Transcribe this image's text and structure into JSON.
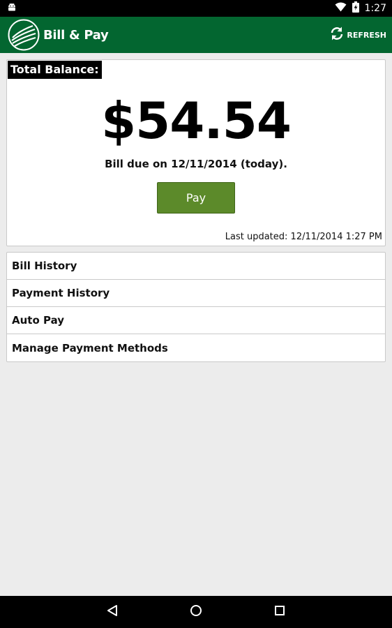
{
  "status_bar": {
    "time": "1:27",
    "left_icon": "android-debug-icon",
    "right_icons": [
      "wifi-icon",
      "battery-charging-icon"
    ]
  },
  "action_bar": {
    "title": "Bill & Pay",
    "logo_icon": "co-op-logo-icon",
    "refresh_label": "REFRESH",
    "refresh_icon": "refresh-icon",
    "background_color": "#036630"
  },
  "balance_card": {
    "label": "Total Balance:",
    "amount": "$54.54",
    "due_text": "Bill due on 12/11/2014 (today).",
    "pay_label": "Pay",
    "pay_color": "#5c8a2a",
    "last_updated": "Last updated: 12/11/2014 1:27 PM"
  },
  "menu": {
    "items": [
      {
        "label": "Bill History"
      },
      {
        "label": "Payment History"
      },
      {
        "label": "Auto Pay"
      },
      {
        "label": "Manage Payment Methods"
      }
    ]
  },
  "nav_bar": {
    "icons": [
      "back-icon",
      "home-icon",
      "recents-icon"
    ]
  }
}
